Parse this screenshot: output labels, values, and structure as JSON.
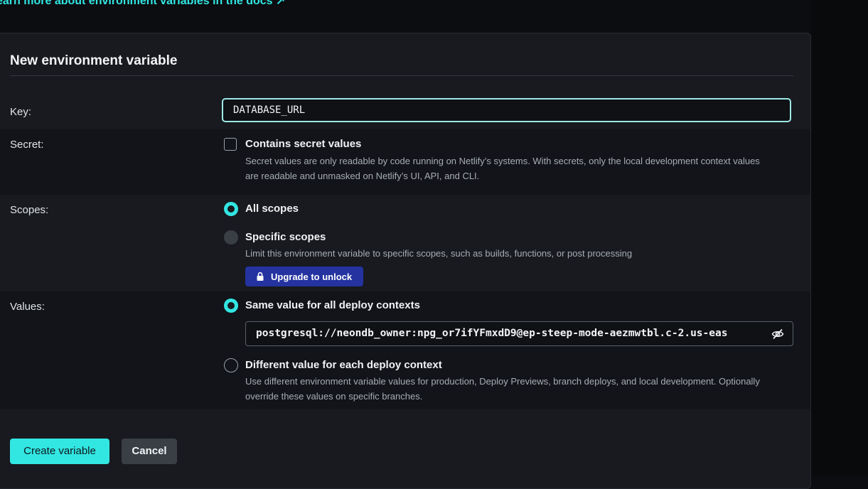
{
  "docs_link": "earn more about environment variables in the docs ↗",
  "form": {
    "title": "New environment variable",
    "key": {
      "label": "Key:",
      "value": "DATABASE_URL"
    },
    "secret": {
      "label": "Secret:",
      "option_title": "Contains secret values",
      "option_desc": "Secret values are only readable by code running on Netlify’s systems. With secrets, only the local development context values are readable and unmasked on Netlify’s UI, API, and CLI.",
      "checked": false
    },
    "scopes": {
      "label": "Scopes:",
      "all_title": "All scopes",
      "specific_title": "Specific scopes",
      "specific_desc": "Limit this environment variable to specific scopes, such as builds, functions, or post processing",
      "upgrade_label": "Upgrade to unlock",
      "selected": "All scopes"
    },
    "values": {
      "label": "Values:",
      "same_title": "Same value for all deploy contexts",
      "value": "postgresql://neondb_owner:npg_or7ifYFmxdD9@ep-steep-mode-aezmwtbl.c-2.us-eas",
      "different_title": "Different value for each deploy context",
      "different_desc": "Use different environment variable values for production, Deploy Previews, branch deploys, and local development. Optionally override these values on specific branches.",
      "selected": "Same value for all deploy contexts"
    },
    "create_label": "Create variable",
    "cancel_label": "Cancel"
  },
  "colors": {
    "accent": "#32e6e2",
    "upgrade": "#2433a0",
    "background": "#0b0d10",
    "card": "#181a1f"
  },
  "icons": {
    "lock": "lock-icon",
    "eye": "eye-off-icon"
  }
}
